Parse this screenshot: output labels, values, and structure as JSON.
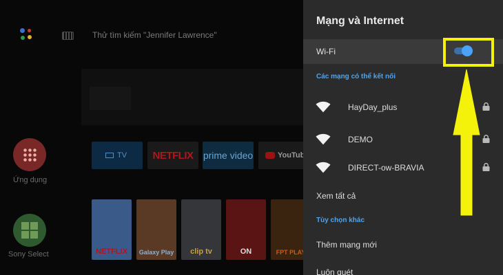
{
  "home": {
    "search_hint": "Thử tìm kiếm \"Jennifer Lawrence\"",
    "side_apps": [
      {
        "label": "Ứng dụng",
        "color": "#7a2727"
      },
      {
        "label": "Sony Select",
        "color": "#2f5a2f"
      }
    ],
    "tiles": {
      "tv": "TV",
      "netflix": "NETFLIX",
      "prime": "prime video",
      "youtube": "YouTube"
    },
    "posters": [
      {
        "brand": "NETFLIX",
        "color": "#3a5a8a",
        "brand_color": "#b0161d"
      },
      {
        "brand": "Galaxy Play",
        "color": "#5a3a24",
        "brand_color": "#8fb0d0"
      },
      {
        "brand": "clip tv",
        "color": "#35363a",
        "brand_color": "#c9a03a"
      },
      {
        "brand": "ON",
        "color": "#5a1414",
        "brand_color": "#dedede"
      },
      {
        "brand": "FPT PLAY",
        "color": "#3a2410",
        "brand_color": "#d05a10"
      }
    ]
  },
  "panel": {
    "title": "Mạng và Internet",
    "wifi": {
      "label": "Wi-Fi",
      "enabled": true
    },
    "available_header": "Các mạng có thể kết nối",
    "networks": [
      {
        "ssid": "HayDay_plus",
        "locked": true
      },
      {
        "ssid": "DEMO",
        "locked": true
      },
      {
        "ssid": "DIRECT-ow-BRAVIA",
        "locked": true
      }
    ],
    "see_all": "Xem tất cả",
    "other_header": "Tùy chọn khác",
    "add_network": "Thêm mạng mới",
    "always_scan": "Luôn quét"
  },
  "annotation": {
    "color": "#f4f20a"
  }
}
